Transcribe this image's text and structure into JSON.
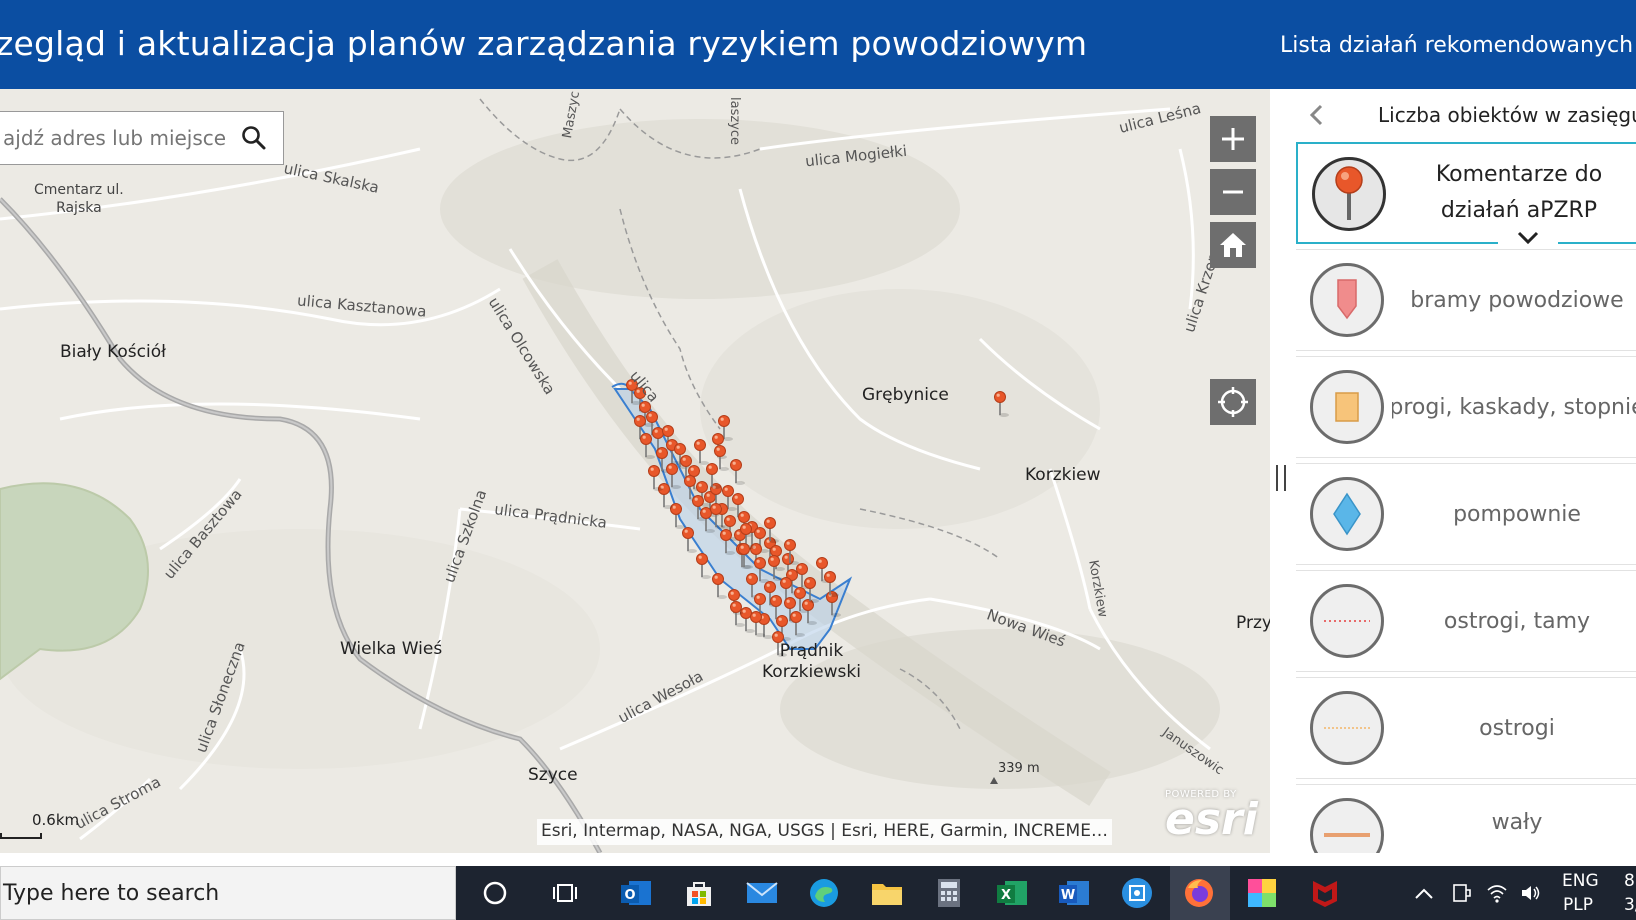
{
  "header": {
    "title": "zegląd i aktualizacja planów zarządzania ryzykiem powodziowym",
    "link": "Lista działań rekomendowanych"
  },
  "search": {
    "placeholder": "ajdź adres lub miejsce"
  },
  "map": {
    "streets": [
      "ulica Skalska",
      "ulica Kasztanowa",
      "ulica Olcowska",
      "ulica Mogiełki",
      "ulica Leśna",
      "Maszyc",
      "laszyce",
      "ulica",
      "ulica Krzemi",
      "ulica Prądnicka",
      "ulica Szkolna",
      "ulica Basztowa",
      "ulica Słoneczna",
      "ulica Wesoła",
      "ulica Stroma",
      "Nowa Wieś",
      "Korzkiew",
      "Januszowic"
    ],
    "places": {
      "cmentarz": "Cmentarz ul.\nRajska",
      "bialy_kosciol": "Biały Kościół",
      "grebynice": "Grębynice",
      "korzkiew": "Korzkiew",
      "wielka_wies": "Wielka Wieś",
      "pradnik": "Prądnik\nKorzkiewski",
      "szyce": "Szyce",
      "przy": "Przy",
      "elevation": "339 m"
    },
    "scale": "0.6km",
    "attribution": "Esri, Intermap, NASA, NGA, USGS | Esri, HERE, Garmin, INCREME…",
    "esri_powered": "POWERED BY",
    "esri_brand": "esri",
    "marker_color": "#e8572a"
  },
  "panel": {
    "title": "Liczba obiektów w zasięgu",
    "layers": [
      {
        "label": "Komentarze do działań aPZRP",
        "icon": "map-pin-icon",
        "active": true
      },
      {
        "label": "bramy powodziowe",
        "icon": "flag-marker-icon",
        "active": false
      },
      {
        "label": "progi, kaskady, stopnie",
        "icon": "square-icon",
        "active": false
      },
      {
        "label": "pompownie",
        "icon": "diamond-icon",
        "active": false
      },
      {
        "label": "ostrogi, tamy",
        "icon": "dotted-line-icon",
        "active": false
      },
      {
        "label": "ostrogi",
        "icon": "dashed-line-icon",
        "active": false
      },
      {
        "label": "wały",
        "icon": "solid-line-icon",
        "active": false
      }
    ]
  },
  "taskbar": {
    "search_text": "Type here to search",
    "lang_top": "ENG",
    "lang_bottom": "PLP",
    "time": "8",
    "date": "3/"
  }
}
